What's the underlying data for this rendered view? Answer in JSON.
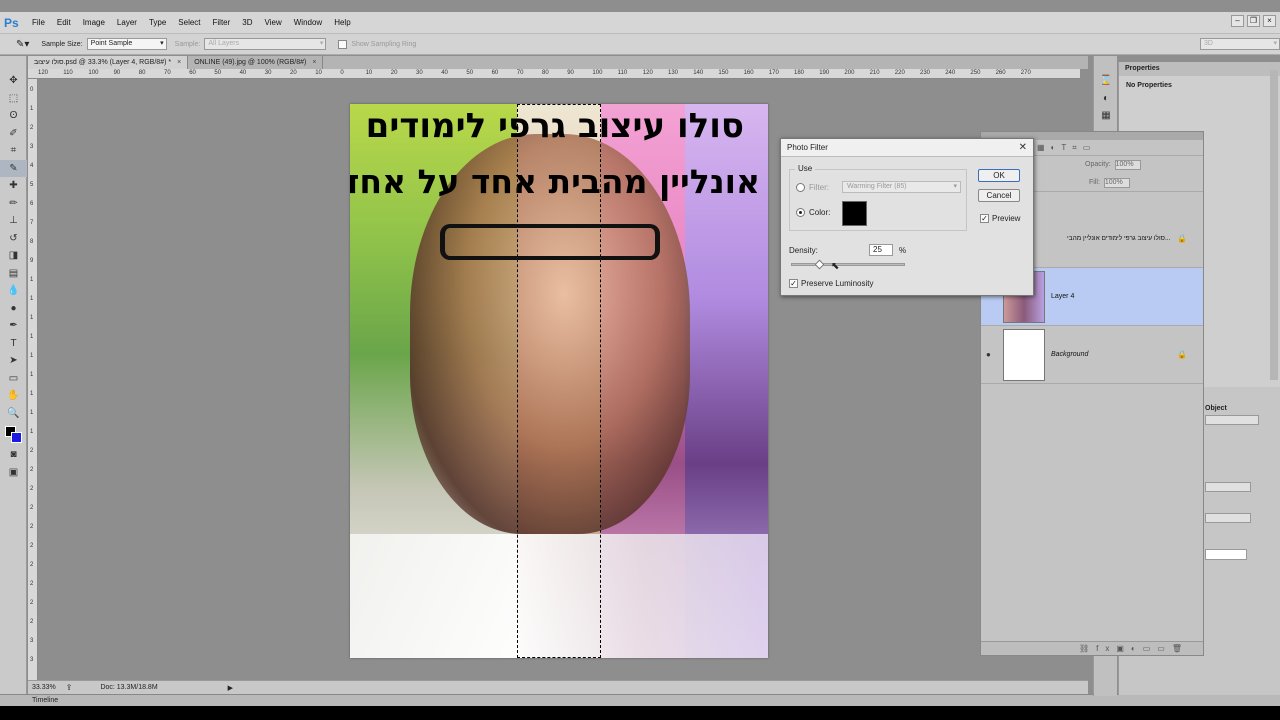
{
  "app": {
    "logo": "Ps"
  },
  "menubar": {
    "items": [
      "File",
      "Edit",
      "Image",
      "Layer",
      "Type",
      "Select",
      "Filter",
      "3D",
      "View",
      "Window",
      "Help"
    ]
  },
  "options": {
    "sample_size_label": "Sample Size:",
    "sample_size_value": "Point Sample",
    "sample_label": "Sample:",
    "sample_value": "All Layers",
    "show_ring_label": "Show Sampling Ring",
    "workspace_value": "3D"
  },
  "doc_tabs": [
    {
      "label": "סולו עיצוב.psd @ 33.3% (Layer 4, RGB/8#) *",
      "close": "×"
    },
    {
      "label": "ONLINE (49).jpg @ 100% (RGB/8#)",
      "close": "×"
    }
  ],
  "ruler_h": [
    "120",
    "110",
    "100",
    "90",
    "80",
    "70",
    "60",
    "50",
    "40",
    "30",
    "20",
    "10",
    "0",
    "10",
    "20",
    "30",
    "40",
    "50",
    "60",
    "70",
    "80",
    "90",
    "100",
    "110",
    "120",
    "130",
    "140",
    "150",
    "160",
    "170",
    "180",
    "190",
    "200",
    "210",
    "220",
    "230",
    "240",
    "250",
    "260",
    "270"
  ],
  "ruler_v": [
    "0",
    "1",
    "2",
    "3",
    "4",
    "5",
    "6",
    "7",
    "8",
    "9",
    "1",
    "1",
    "1",
    "1",
    "1",
    "1",
    "1",
    "1",
    "1",
    "2",
    "2",
    "2",
    "2",
    "2",
    "2",
    "2",
    "2",
    "2",
    "2",
    "3",
    "3"
  ],
  "photo": {
    "title_line1": "סולו עיצוב גרפי לימודים",
    "title_line2": "אונליין מהבית אחד על אחד"
  },
  "status": {
    "zoom": "33.33%",
    "doc": "Doc: 13.3M/18.8M"
  },
  "timeline_label": "Timeline",
  "properties": {
    "tab": "Properties",
    "message": "No Properties",
    "object_label": "Object"
  },
  "layers": {
    "opacity_label": "Opacity:",
    "opacity_value": "100%",
    "fill_label": "Fill:",
    "fill_value": "100%",
    "rows": [
      {
        "name": "סולו עיצוב גרפי לימודים  אונליין מהבי..."
      },
      {
        "name": "Layer 4"
      },
      {
        "name": "Background"
      }
    ]
  },
  "dialog": {
    "title": "Photo Filter",
    "use_label": "Use",
    "filter_label": "Filter:",
    "filter_value": "Warming Filter (85)",
    "color_label": "Color:",
    "color_value": "#000000",
    "ok": "OK",
    "cancel": "Cancel",
    "preview_label": "Preview",
    "preview_checked": true,
    "density_label": "Density:",
    "density_value": "25",
    "density_unit": "%",
    "density_fraction": 0.25,
    "preserve_label": "Preserve Luminosity",
    "preserve_checked": true
  },
  "tools": [
    "move-icon",
    "marquee-icon",
    "lasso-icon",
    "quick-select-icon",
    "crop-icon",
    "eyedropper-icon",
    "healing-icon",
    "brush-icon",
    "stamp-icon",
    "history-brush-icon",
    "eraser-icon",
    "gradient-icon",
    "blur-icon",
    "dodge-icon",
    "pen-icon",
    "type-icon",
    "path-select-icon",
    "shape-icon",
    "hand-icon",
    "zoom-icon"
  ]
}
